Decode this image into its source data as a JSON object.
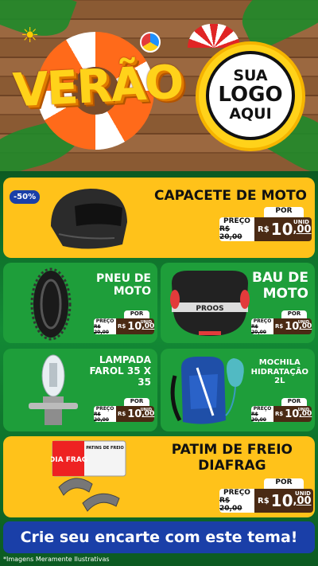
{
  "header": {
    "title": "VERÃO",
    "logo_line1": "SUA",
    "logo_line2": "LOGO",
    "logo_line3": "AQUI"
  },
  "colors": {
    "yellow": "#ffc21a",
    "green": "#1e9e3a",
    "blue": "#1a3fa8",
    "brown": "#4a2a14"
  },
  "products": [
    {
      "name": "CAPACETE DE MOTO",
      "discount": "-50%",
      "price_label": "PREÇO",
      "old_price": "R$ 20,00",
      "por": "POR",
      "currency": "R$",
      "price_int": "10",
      "price_cents": ",00",
      "unit": "UNID"
    },
    {
      "name_l1": "PNEU DE",
      "name_l2": "MOTO",
      "price_label": "PREÇO",
      "old_price": "R$ 20,00",
      "por": "POR",
      "currency": "R$",
      "price_int": "10",
      "price_cents": ",00",
      "unit": "UNID"
    },
    {
      "name_l1": "BAU DE",
      "name_l2": "MOTO",
      "brand": "PROOS",
      "price_label": "PREÇO",
      "old_price": "R$ 20,00",
      "por": "POR",
      "currency": "R$",
      "price_int": "10",
      "price_cents": ",00",
      "unit": "UNID"
    },
    {
      "name_l1": "LAMPADA",
      "name_l2": "FAROL 35 X",
      "name_l3": "35",
      "price_label": "PREÇO",
      "old_price": "R$ 20,00",
      "por": "POR",
      "currency": "R$",
      "price_int": "10",
      "price_cents": ",00",
      "unit": "UNID"
    },
    {
      "name_l1": "MOCHILA",
      "name_l2": "HIDRATAÇÃO",
      "name_l3": "2L",
      "price_label": "PREÇO",
      "old_price": "R$ 20,00",
      "por": "POR",
      "currency": "R$",
      "price_int": "10",
      "price_cents": ",00",
      "unit": "UNID"
    },
    {
      "name_l1": "PATIM DE FREIO",
      "name_l2": "DIAFRAG",
      "brand": "DIA FRAG",
      "box_text": "PATINS DE FREIO",
      "price_label": "PREÇO",
      "old_price": "R$ 20,00",
      "por": "POR",
      "currency": "R$",
      "price_int": "10",
      "price_cents": ",00",
      "unit": "UNID"
    }
  ],
  "footer": {
    "cta": "Crie seu encarte com este tema!",
    "note": "*Imagens Meramente Ilustrativas"
  }
}
